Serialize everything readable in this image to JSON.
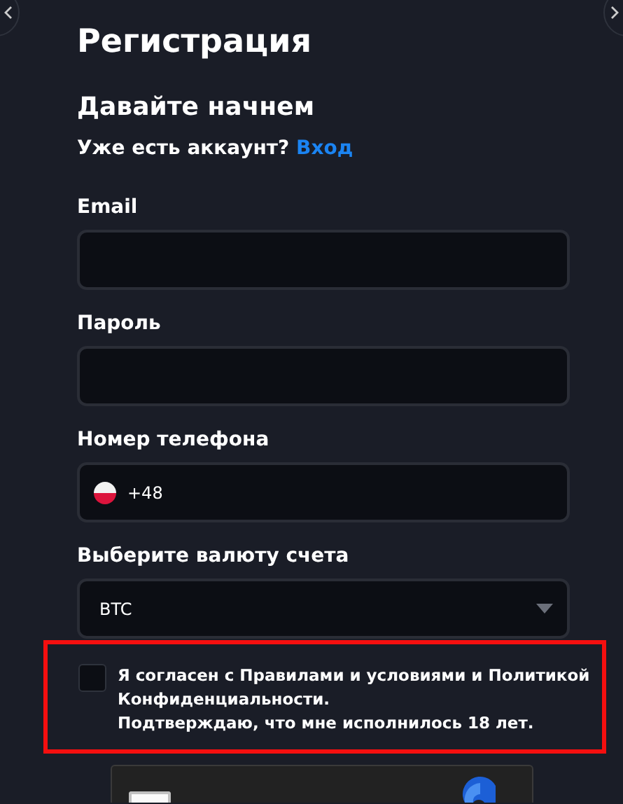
{
  "title": "Регистрация",
  "subtitle": "Давайте начнем",
  "login_prompt": {
    "text": "Уже есть аккаунт?",
    "link": "Вход"
  },
  "fields": [
    {
      "kind": "text",
      "label": "Email"
    },
    {
      "kind": "text",
      "label": "Пароль"
    },
    {
      "kind": "phone",
      "label": "Номер телефона",
      "value": "+48"
    },
    {
      "kind": "select",
      "label": "Выберите валюту счета",
      "value": "BTC"
    }
  ],
  "agreement": {
    "checked": false,
    "highlighted": true,
    "lines": [
      "Я согласен с Правилами и условиями и Политикой Конфиденциальности.",
      "Подтверждаю, что мне исполнилось 18 лет."
    ]
  },
  "captcha": {
    "checked": false
  }
}
